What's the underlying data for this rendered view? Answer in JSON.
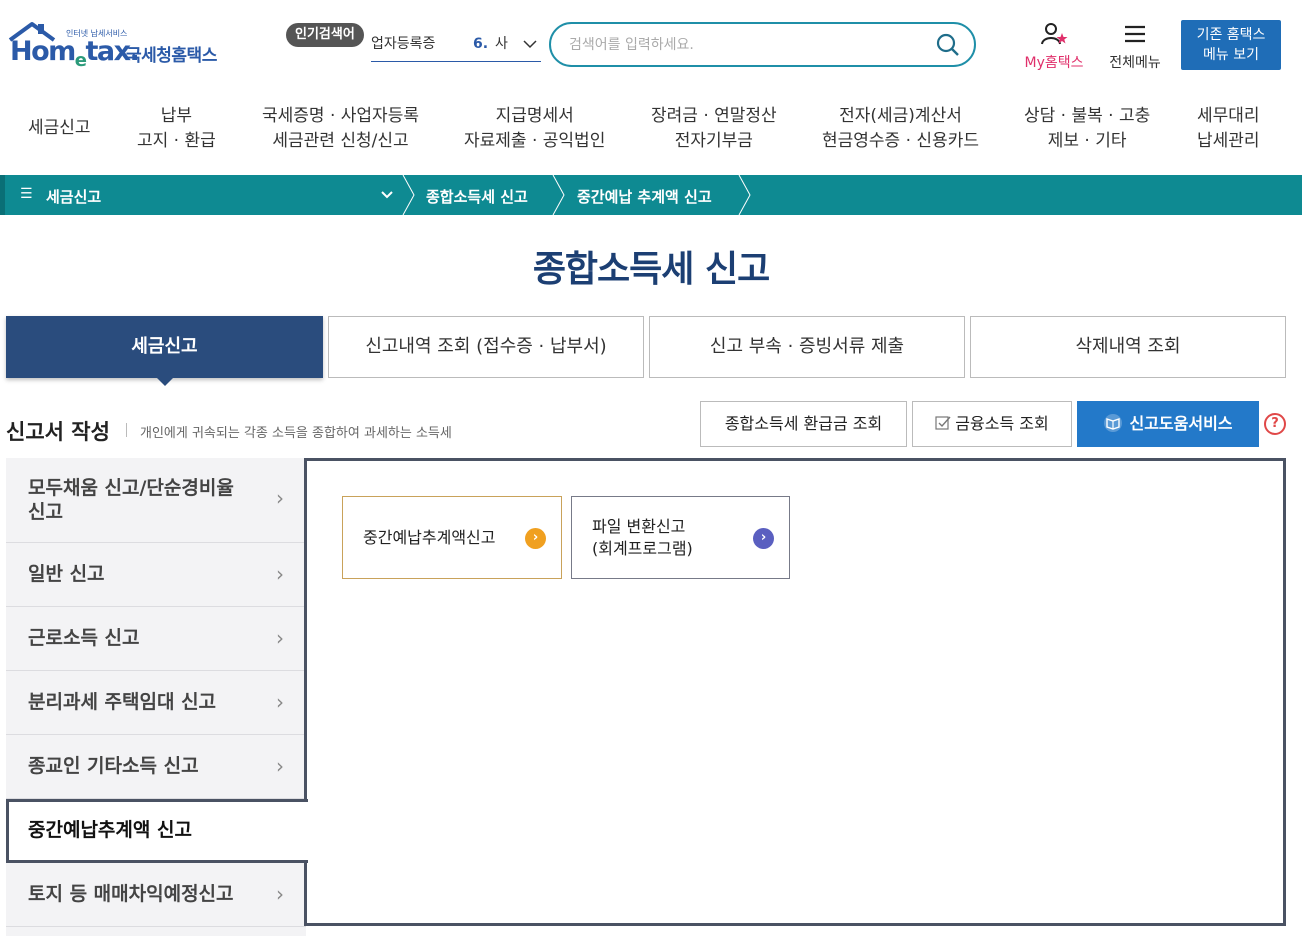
{
  "header": {
    "logo_small": "인터넷 납세서비스",
    "logo_word_a": "Hom",
    "logo_word_e": "e",
    "logo_word_b": "tax.",
    "logo_kname": "국세청홈택스",
    "popular_badge": "인기검색어",
    "popular_term": "업자등록증",
    "popular_rank": "6.",
    "popular_term2": "사",
    "search_placeholder": "검색어를 입력하세요.",
    "my_home": "My홈택스",
    "all_menu": "전체메뉴",
    "old_home_line1": "기존 홈택스",
    "old_home_line2": "메뉴 보기"
  },
  "gnb": [
    {
      "line1": "세금신고",
      "line2": ""
    },
    {
      "line1": "납부",
      "line2": "고지 · 환급"
    },
    {
      "line1": "국세증명 · 사업자등록",
      "line2": "세금관련 신청/신고"
    },
    {
      "line1": "지급명세서",
      "line2": "자료제출 · 공익법인"
    },
    {
      "line1": "장려금 · 연말정산",
      "line2": "전자기부금"
    },
    {
      "line1": "전자(세금)계산서",
      "line2": "현금영수증 · 신용카드"
    },
    {
      "line1": "상담 · 불복 · 고충",
      "line2": "제보 · 기타"
    },
    {
      "line1": "세무대리",
      "line2": "납세관리"
    }
  ],
  "breadcrumb": {
    "level1": "세금신고",
    "level2": "종합소득세 신고",
    "level3": "중간예납 추계액 신고"
  },
  "page_title": "종합소득세 신고",
  "tabs": [
    {
      "label": "세금신고"
    },
    {
      "label": "신고내역 조회 (접수증 · 납부서)"
    },
    {
      "label": "신고 부속 · 증빙서류 제출"
    },
    {
      "label": "삭제내역 조회"
    }
  ],
  "section": {
    "title": "신고서 작성",
    "desc": "개인에게 귀속되는 각종 소득을 종합하여 과세하는 소득세",
    "btn_refund": "종합소득세 환급금 조회",
    "btn_finance": "금융소득 조회",
    "btn_help": "신고도움서비스",
    "help_mark": "?"
  },
  "side_menu": [
    {
      "label": "모두채움 신고/단순경비율 신고"
    },
    {
      "label": "일반 신고"
    },
    {
      "label": "근로소득 신고"
    },
    {
      "label": "분리과세 주택임대 신고"
    },
    {
      "label": "종교인 기타소득 신고"
    },
    {
      "label": "중간예납추계액 신고"
    },
    {
      "label": "토지 등 매매차익예정신고"
    }
  ],
  "cards": [
    {
      "line1": "중간예납추계액신고",
      "line2": ""
    },
    {
      "line1": "파일 변환신고",
      "line2": "(회계프로그램)"
    }
  ],
  "colors": {
    "brand_blue": "#2b5aa8",
    "teal_bar": "#0e8a92",
    "active_tab": "#2a4c7d",
    "help_button": "#2379c9",
    "card1_accent": "#f0a020",
    "card2_accent": "#5a5fc0"
  }
}
